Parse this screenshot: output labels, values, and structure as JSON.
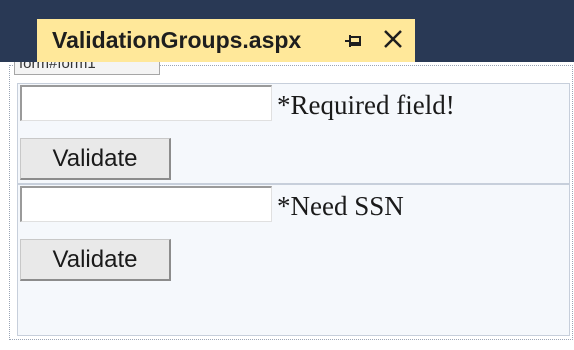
{
  "tab": {
    "title": "ValidationGroups.aspx",
    "pin_icon": "pin-icon",
    "close_icon": "close-icon"
  },
  "design": {
    "form_tag": "form#form1",
    "groups": [
      {
        "validator_message": "*Required field!",
        "button_label": "Validate"
      },
      {
        "validator_message": "*Need SSN",
        "button_label": "Validate"
      }
    ]
  },
  "colors": {
    "titlebar": "#293955",
    "active_tab": "#ffe89a",
    "panel": "#f5f8fc"
  }
}
